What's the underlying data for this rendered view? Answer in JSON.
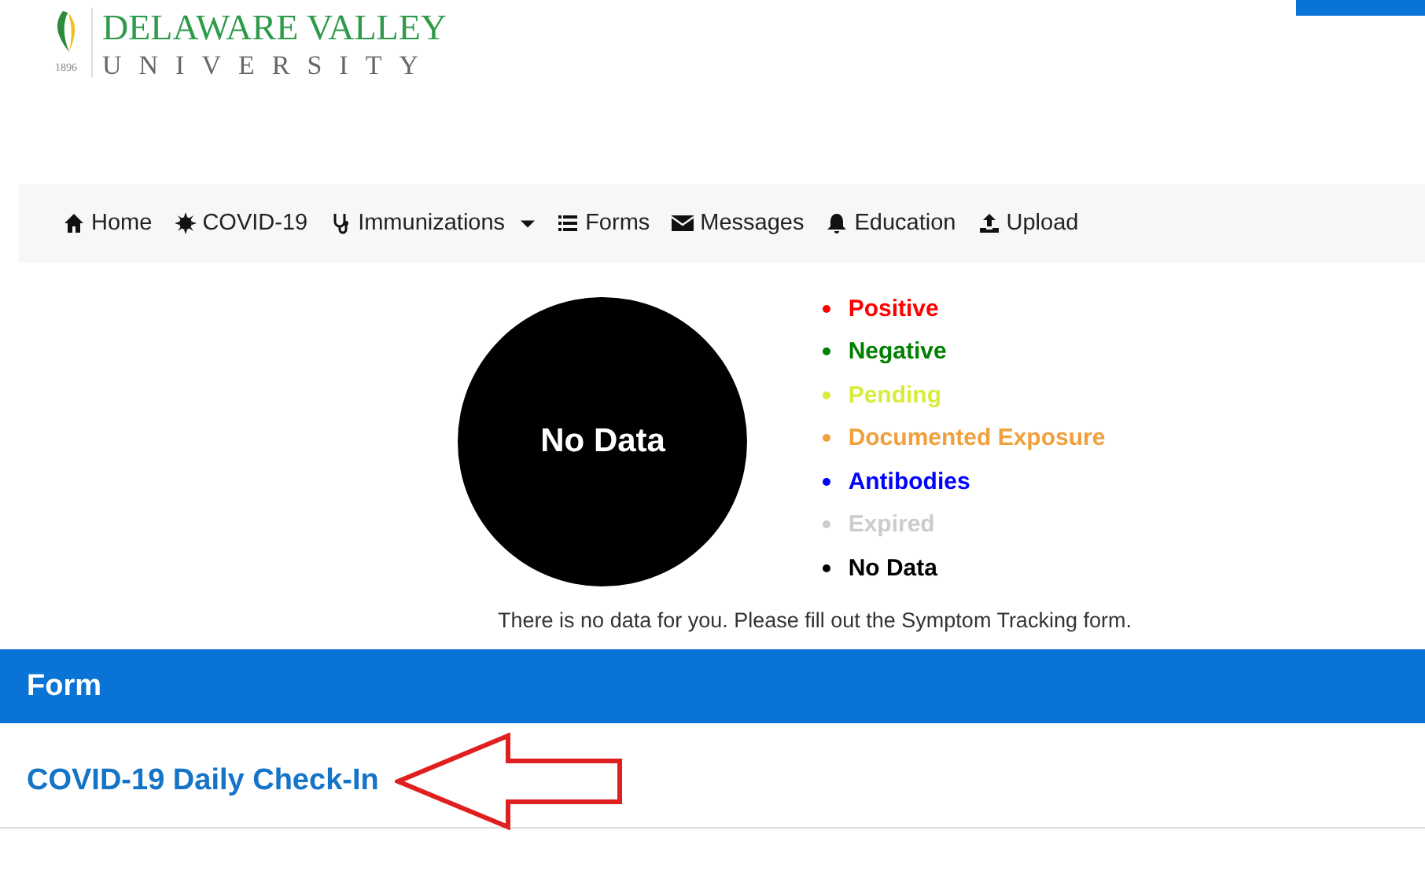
{
  "logo": {
    "name": "DELAWARE VALLEY",
    "subtitle": "UNIVERSITY",
    "year": "1896"
  },
  "nav": [
    {
      "label": "Home",
      "has_menu": false
    },
    {
      "label": "COVID-19",
      "has_menu": false
    },
    {
      "label": "Immunizations",
      "has_menu": true
    },
    {
      "label": "Forms",
      "has_menu": false
    },
    {
      "label": "Messages",
      "has_menu": false
    },
    {
      "label": "Education",
      "has_menu": false
    },
    {
      "label": "Upload",
      "has_menu": false
    }
  ],
  "status_chart": {
    "label": "No Data"
  },
  "legend": [
    {
      "label": "Positive",
      "color": "#ff0000"
    },
    {
      "label": "Negative",
      "color": "#008000"
    },
    {
      "label": "Pending",
      "color": "#d9ec3c"
    },
    {
      "label": "Documented Exposure",
      "color": "#f0a03c"
    },
    {
      "label": "Antibodies",
      "color": "#0000ff"
    },
    {
      "label": "Expired",
      "color": "#cccccc"
    },
    {
      "label": "No Data",
      "color": "#000000"
    }
  ],
  "message": "There is no data for you. Please fill out the Symptom Tracking form.",
  "form_panel": {
    "title": "Form",
    "link": "COVID-19 Daily Check-In"
  }
}
